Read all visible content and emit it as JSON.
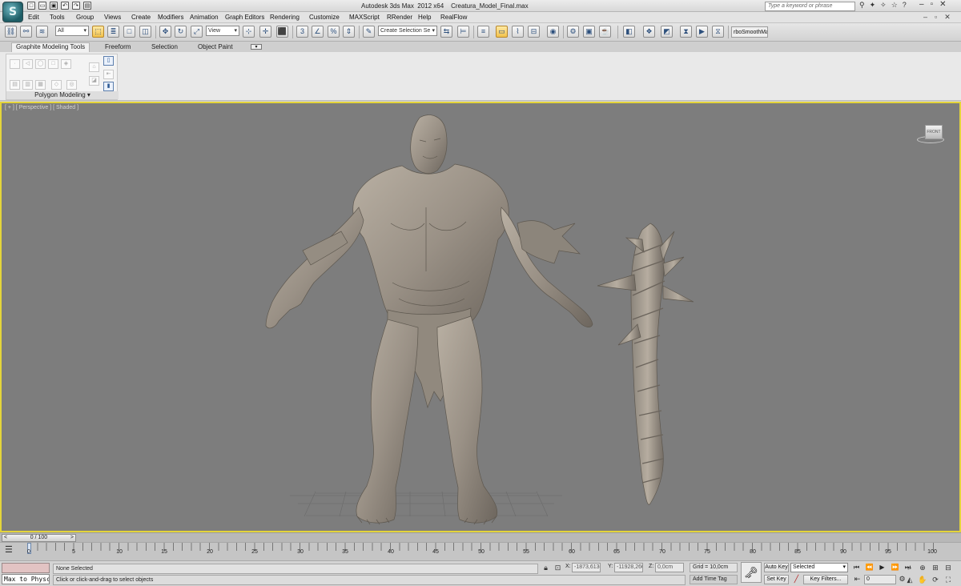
{
  "title_bar": {
    "app_name": "Autodesk 3ds Max  2012 x64",
    "file_name": "Creatura_Model_Final.max",
    "search_placeholder": "Type a keyword or phrase",
    "app_logo": "3ds-max-logo",
    "quick_access": [
      "new-icon",
      "open-icon",
      "save-icon",
      "undo-icon",
      "redo-icon",
      "project-icon"
    ]
  },
  "menu": [
    "Edit",
    "Tools",
    "Group",
    "Views",
    "Create",
    "Modifiers",
    "Animation",
    "Graph Editors",
    "Rendering",
    "Customize",
    "MAXScript",
    "RRender",
    "Help",
    "RealFlow"
  ],
  "toolbar": {
    "filter_value": "All",
    "reference_coord_value": "View",
    "named_selection_placeholder": "Create Selection Se",
    "turbosmooth_label": "rboSmoothMa"
  },
  "ribbon": {
    "tabs": [
      "Graphite Modeling Tools",
      "Freeform",
      "Selection",
      "Object Paint"
    ],
    "active_tab": "Graphite Modeling Tools",
    "group_label": "Polygon Modeling"
  },
  "viewport": {
    "label": "[ + ] [ Perspective ] [ Shaded ]",
    "viewcube_face": "FRONT",
    "border_color": "#e4d43a",
    "background_color": "#7d7d7d"
  },
  "time_slider": {
    "position_label": "0 / 100",
    "prev_arrow": "<",
    "next_arrow": ">"
  },
  "trackbar": {
    "ticks": [
      "0",
      "5",
      "10",
      "15",
      "20",
      "25",
      "30",
      "35",
      "40",
      "45",
      "50",
      "55",
      "60",
      "65",
      "70",
      "75",
      "80",
      "85",
      "90",
      "95",
      "100"
    ]
  },
  "status": {
    "maxscript_listener": "Max to Physc.",
    "selection_status": "None Selected",
    "prompt": "Click or click-and-drag to select objects",
    "x_label": "X:",
    "x_value": "-1873,613c",
    "y_label": "Y:",
    "y_value": "-11928,260",
    "z_label": "Z:",
    "z_value": "0,0cm",
    "grid": "Grid = 10,0cm",
    "add_time_tag": "Add Time Tag",
    "auto_key": "Auto Key",
    "set_key": "Set Key",
    "key_mode_value": "Selected",
    "key_filters": "Key Filters...",
    "current_frame": "0"
  }
}
